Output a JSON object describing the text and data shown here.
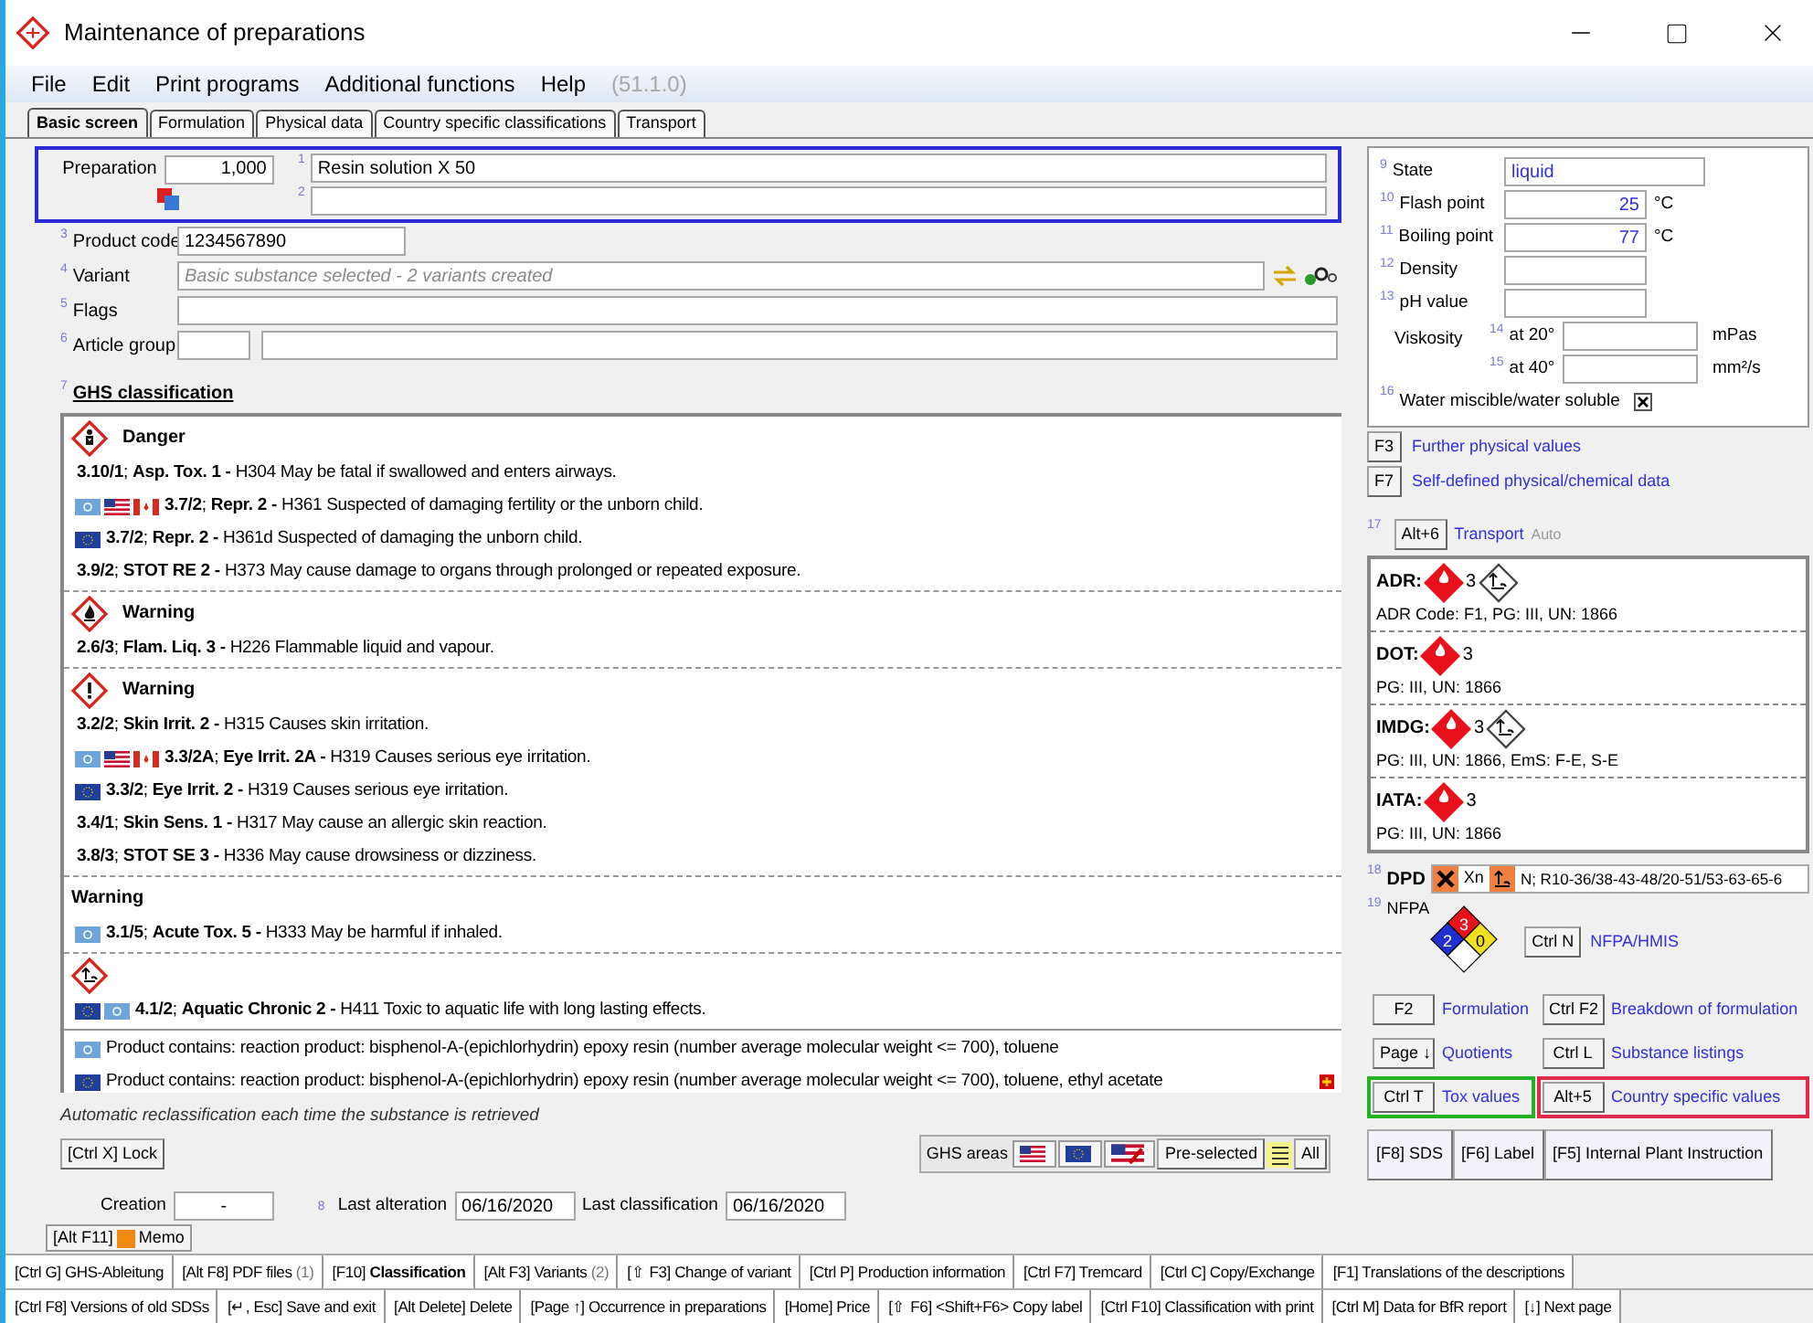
{
  "window": {
    "title": "Maintenance of preparations"
  },
  "menu": [
    {
      "label": "File"
    },
    {
      "label": "Edit"
    },
    {
      "label": "Print programs"
    },
    {
      "label": "Additional functions"
    },
    {
      "label": "Help"
    }
  ],
  "version": "(51.1.0)",
  "tabs": [
    {
      "label": "Basic screen",
      "selected": true
    },
    {
      "label": "Formulation",
      "selected": false
    },
    {
      "label": "Physical data",
      "selected": false
    },
    {
      "label": "Country specific classifications",
      "selected": false
    },
    {
      "label": "Transport",
      "selected": false
    }
  ],
  "header": {
    "color": "#2b2bd6",
    "label": "Preparation",
    "number": "1,000",
    "lines": [
      {
        "index": "1",
        "value": "Resin solution X 50"
      },
      {
        "index": "2"
      }
    ]
  },
  "fields": [
    {
      "index": "3",
      "label": "Product code",
      "kind": "short",
      "value": "1234567890"
    },
    {
      "index": "4",
      "label": "Variant",
      "kind": "variant",
      "placeholder": "Basic substance selected - 2 variants created"
    },
    {
      "index": "5",
      "label": "Flags",
      "kind": "wide"
    },
    {
      "index": "6",
      "label": "Article group",
      "kind": "pair"
    }
  ],
  "ghs": {
    "index": "7",
    "title": "GHS classification",
    "groups": [
      {
        "kind": "health",
        "signal": "Danger",
        "statements": [
          {
            "text": "**3.10/1**; **Asp. Tox. 1 -** H304 May be fatal if swallowed and enters airways."
          },
          {
            "flags": [
              {
                "kind": "un"
              },
              {
                "kind": "us"
              },
              {
                "kind": "ca"
              }
            ],
            "text": "**3.7/2**; **Repr. 2 -** H361 Suspected of damaging fertility or the unborn child."
          },
          {
            "flags": [
              {
                "kind": "eu"
              }
            ],
            "text": "**3.7/2**; **Repr. 2 -** H361d Suspected of damaging the unborn child."
          },
          {
            "text": "**3.9/2**; **STOT RE 2 -** H373 May cause damage to organs through prolonged or repeated exposure."
          }
        ]
      },
      {
        "kind": "flame",
        "signal": "Warning",
        "statements": [
          {
            "text": "**2.6/3**; **Flam. Liq. 3 -** H226 Flammable liquid and vapour."
          }
        ]
      },
      {
        "kind": "exclamation",
        "signal": "Warning",
        "statements": [
          {
            "text": "**3.2/2**; **Skin Irrit. 2 -** H315 Causes skin irritation."
          },
          {
            "flags": [
              {
                "kind": "un"
              },
              {
                "kind": "us"
              },
              {
                "kind": "ca"
              }
            ],
            "text": "**3.3/2A**; **Eye Irrit. 2A -** H319 Causes serious eye irritation."
          },
          {
            "flags": [
              {
                "kind": "eu"
              }
            ],
            "text": "**3.3/2**; **Eye Irrit. 2 -** H319 Causes serious eye irritation."
          },
          {
            "text": "**3.4/1**; **Skin Sens. 1 -** H317 May cause an allergic skin reaction."
          },
          {
            "text": "**3.8/3**; **STOT SE 3 -** H336 May cause drowsiness or dizziness."
          }
        ]
      },
      {
        "kind": "plain",
        "signal": "Warning",
        "statements": [
          {
            "flags": [
              {
                "kind": "un"
              }
            ],
            "text": "**3.1/5**; **Acute Tox. 5 -** H333 May be harmful if inhaled."
          }
        ]
      },
      {
        "kind": "environment",
        "statements": [
          {
            "flags": [
              {
                "kind": "eu"
              },
              {
                "kind": "un"
              }
            ],
            "text": "**4.1/2**; **Aquatic Chronic 2 -** H411 Toxic to aquatic life with long lasting effects."
          }
        ]
      }
    ],
    "notes": [
      {
        "flags": [
          {
            "kind": "un"
          }
        ],
        "text": "Product contains: reaction product: bisphenol-A-(epichlorhydrin) epoxy resin (number average molecular weight <= 700), toluene"
      },
      {
        "flags": [
          {
            "kind": "eu"
          }
        ],
        "text": "Product contains: reaction product: bisphenol-A-(epichlorhydrin) epoxy resin (number average molecular weight <= 700), toluene, ethyl acetate"
      }
    ]
  },
  "reclassification_note": "Automatic reclassification each time the substance is retrieved",
  "lock_button": "[Ctrl X] Lock",
  "ghs_areas": {
    "label": "GHS areas",
    "flags": [
      {
        "kind": "us"
      },
      {
        "kind": "eu"
      },
      {
        "kind": "us-edit"
      }
    ],
    "preselected": "Pre-selected",
    "all": "All"
  },
  "dates": {
    "creation_label": "Creation",
    "creation": "-",
    "index": "8",
    "alteration_label": "Last alteration",
    "alteration": "06/16/2020",
    "classification_label": "Last classification",
    "classification": "06/16/2020"
  },
  "memo": {
    "key": "[Alt F11]",
    "label": "Memo"
  },
  "physical": {
    "rows": [
      {
        "index": "9",
        "label": "State",
        "kind": "text",
        "value": "liquid"
      },
      {
        "index": "10",
        "label": "Flash point",
        "kind": "number",
        "value": "25",
        "unit": "°C"
      },
      {
        "index": "11",
        "label": "Boiling point",
        "kind": "number",
        "value": "77",
        "unit": "°C"
      },
      {
        "index": "12",
        "label": "Density",
        "kind": "number"
      },
      {
        "index": "13",
        "label": "pH value",
        "kind": "number"
      }
    ],
    "viscosity": {
      "label": "Viskosity",
      "rows": [
        {
          "index": "14",
          "label": "at 20°",
          "unit": "mPas"
        },
        {
          "index": "15",
          "label": "at 40°",
          "unit": "mm²/s"
        }
      ]
    },
    "water": {
      "index": "16",
      "label": "Water miscible/water soluble",
      "checked": true
    }
  },
  "physical_links": [
    {
      "key": "F3",
      "label": "Further physical values"
    },
    {
      "key": "F7",
      "label": "Self-defined physical/chemical data"
    }
  ],
  "transport": {
    "index": "17",
    "key": "Alt+6",
    "label": "Transport",
    "mode": "Auto",
    "entries": [
      {
        "name": "ADR:",
        "class": "3",
        "marine": true,
        "detail": "ADR Code: F1, PG: III, UN: 1866"
      },
      {
        "name": "DOT:",
        "class": "3",
        "marine": false,
        "detail": "PG: III, UN: 1866"
      },
      {
        "name": "IMDG:",
        "class": "3",
        "marine": true,
        "detail": "PG: III, UN: 1866, EmS: F-E, S-E"
      },
      {
        "name": "IATA:",
        "class": "3",
        "marine": false,
        "detail": "PG: III, UN: 1866"
      }
    ]
  },
  "dpd": {
    "index": "18",
    "label": "DPD",
    "symbol": "Xn",
    "phrases": "N; R10-36/38-43-48/20-51/53-63-65-6"
  },
  "nfpa": {
    "index": "19",
    "label": "NFPA",
    "flammability": "3",
    "health": "2",
    "reactivity": "0",
    "key": "Ctrl N",
    "link": "NFPA/HMIS"
  },
  "actions": [
    {
      "key": "F2",
      "label": "Formulation"
    },
    {
      "key": "Ctrl F2",
      "label": "Breakdown of formulation"
    },
    {
      "key": "Page ↓",
      "label": "Quotients"
    },
    {
      "key": "Ctrl L",
      "label": "Substance listings"
    },
    {
      "key": "Ctrl T",
      "label": "Tox values",
      "color": "#22b322"
    },
    {
      "key": "Alt+5",
      "label": "Country specific values",
      "color": "#e0284a"
    }
  ],
  "documents": [
    "[F8] SDS",
    "[F6] Label",
    "[F5] Internal Plant Instruction"
  ],
  "function_bar": [
    [
      {
        "label": "[Ctrl G] GHS-Ableitung"
      },
      {
        "label": "[Alt F8] PDF files",
        "count": "(1)"
      },
      {
        "label": "[F10] **Classification**"
      },
      {
        "label": "[Alt F3] Variants",
        "count": "(2)"
      },
      {
        "label": "[⇧ F3] Change of variant"
      },
      {
        "label": "[Ctrl P] Production information"
      },
      {
        "label": "[Ctrl F7] Tremcard"
      },
      {
        "label": "[Ctrl C] Copy/Exchange"
      },
      {
        "label": "[F1] Translations of the descriptions"
      }
    ],
    [
      {
        "label": "[Ctrl F8] Versions of old SDSs"
      },
      {
        "label": "[↵, Esc] Save and exit"
      },
      {
        "label": "[Alt Delete] Delete"
      },
      {
        "label": "[Page ↑] Occurrence in preparations"
      },
      {
        "label": "[Home] Price"
      },
      {
        "label": "[⇧ F6] <Shift+F6> Copy label"
      },
      {
        "label": "[Ctrl F10] Classification with print"
      },
      {
        "label": "[Ctrl M] Data for BfR report"
      },
      {
        "label": "[↓] Next page"
      }
    ]
  ]
}
